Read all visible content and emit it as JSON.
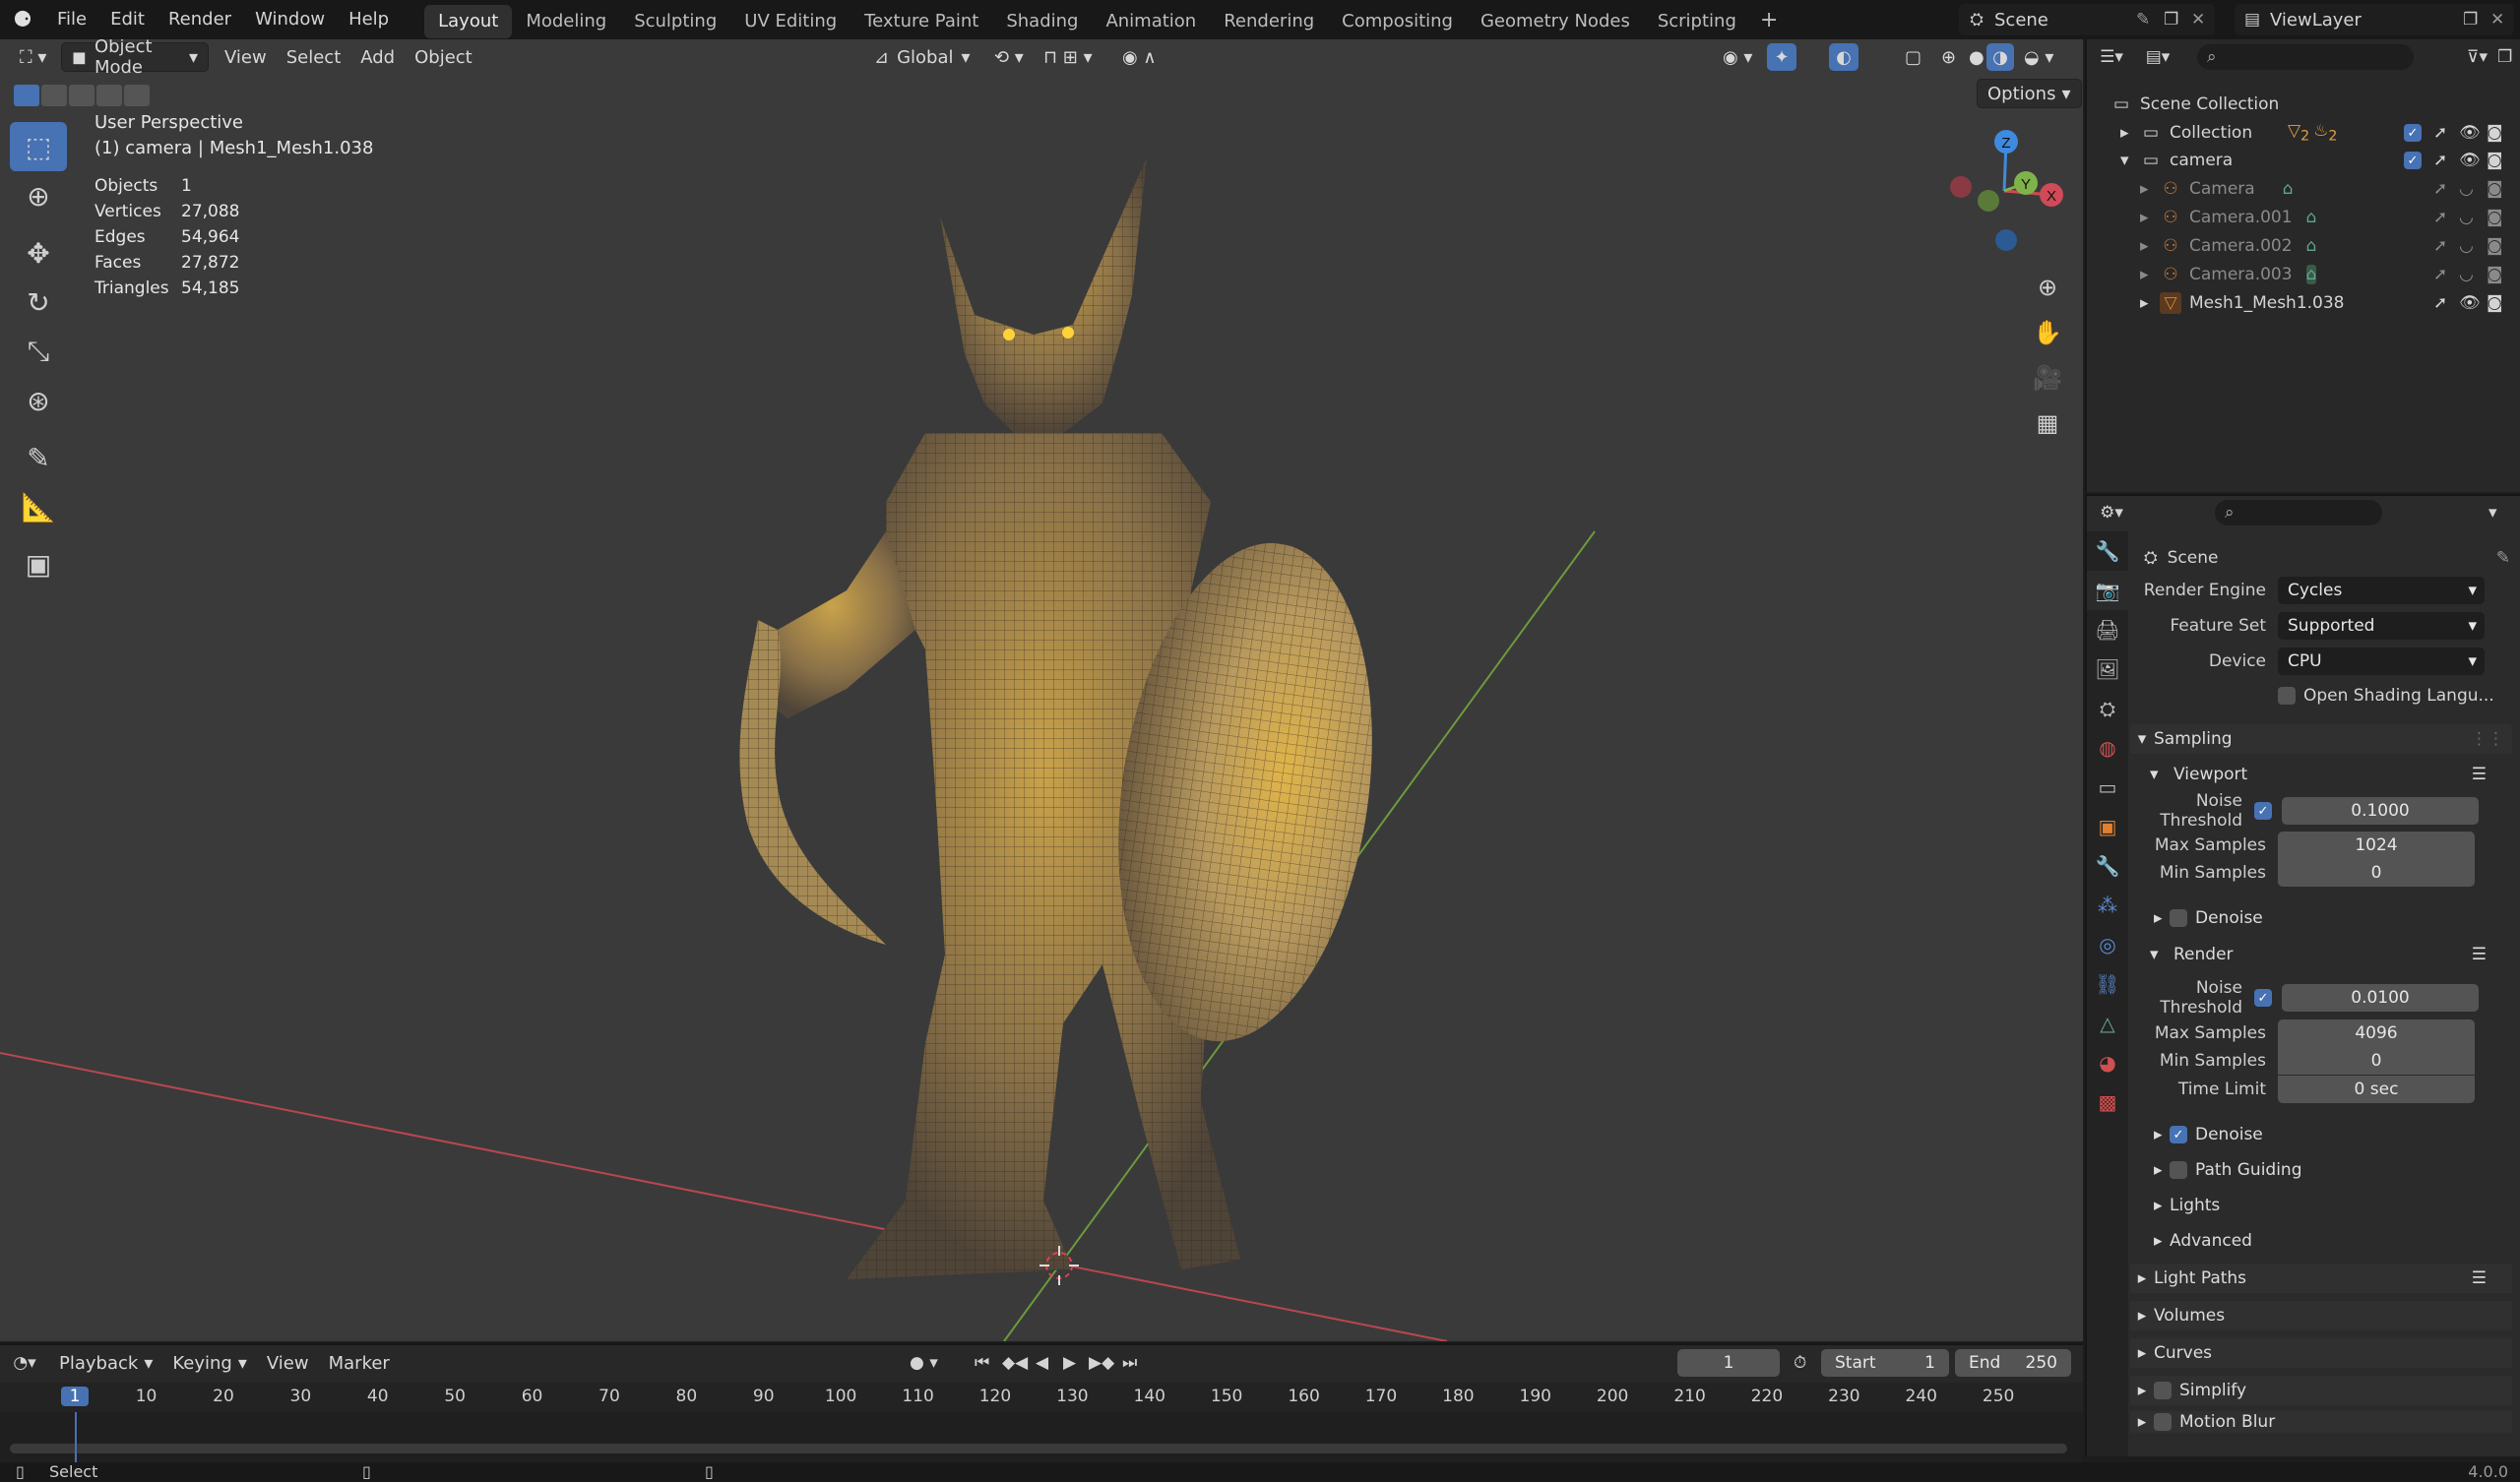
{
  "topbar": {
    "menus": [
      "File",
      "Edit",
      "Render",
      "Window",
      "Help"
    ],
    "workspaces": [
      "Layout",
      "Modeling",
      "Sculpting",
      "UV Editing",
      "Texture Paint",
      "Shading",
      "Animation",
      "Rendering",
      "Compositing",
      "Geometry Nodes",
      "Scripting"
    ],
    "active_workspace": "Layout",
    "scene_name": "Scene",
    "view_layer": "ViewLayer"
  },
  "viewport": {
    "mode": "Object Mode",
    "menus": [
      "View",
      "Select",
      "Add",
      "Object"
    ],
    "orientation": "Global",
    "options_label": "Options",
    "view_name": "User Perspective",
    "object_info": "(1) camera | Mesh1_Mesh1.038",
    "stats": [
      {
        "label": "Objects",
        "value": "1"
      },
      {
        "label": "Vertices",
        "value": "27,088"
      },
      {
        "label": "Edges",
        "value": "54,964"
      },
      {
        "label": "Faces",
        "value": "27,872"
      },
      {
        "label": "Triangles",
        "value": "54,185"
      }
    ],
    "gizmo": {
      "x": "X",
      "y": "Y",
      "z": "Z"
    }
  },
  "outliner": {
    "root": "Scene Collection",
    "items": [
      {
        "name": "Collection",
        "level": 1
      },
      {
        "name": "camera",
        "level": 1
      },
      {
        "name": "Camera",
        "level": 2
      },
      {
        "name": "Camera.001",
        "level": 2
      },
      {
        "name": "Camera.002",
        "level": 2
      },
      {
        "name": "Camera.003",
        "level": 2
      },
      {
        "name": "Mesh1_Mesh1.038",
        "level": 2
      }
    ],
    "collection_badges": [
      "2",
      "2"
    ]
  },
  "properties": {
    "context": "Scene",
    "render_engine_label": "Render Engine",
    "render_engine": "Cycles",
    "feature_set_label": "Feature Set",
    "feature_set": "Supported",
    "device_label": "Device",
    "device": "CPU",
    "osl_label": "Open Shading Langu...",
    "sampling": "Sampling",
    "viewport": "Viewport",
    "vp_noise_label": "Noise Threshold",
    "vp_noise": "0.1000",
    "vp_max_label": "Max Samples",
    "vp_max": "1024",
    "vp_min_label": "Min Samples",
    "vp_min": "0",
    "vp_denoise": "Denoise",
    "render": "Render",
    "r_noise_label": "Noise Threshold",
    "r_noise": "0.0100",
    "r_max_label": "Max Samples",
    "r_max": "4096",
    "r_min_label": "Min Samples",
    "r_min": "0",
    "r_time_label": "Time Limit",
    "r_time": "0 sec",
    "r_denoise": "Denoise",
    "path_guiding": "Path Guiding",
    "lights": "Lights",
    "advanced": "Advanced",
    "light_paths": "Light Paths",
    "volumes": "Volumes",
    "curves": "Curves",
    "simplify": "Simplify",
    "motion_blur": "Motion Blur"
  },
  "timeline": {
    "menus": [
      "Playback",
      "Keying",
      "View",
      "Marker"
    ],
    "current_frame": "1",
    "start_label": "Start",
    "start": "1",
    "end_label": "End",
    "end": "250",
    "ruler": [
      "1",
      "10",
      "20",
      "30",
      "40",
      "50",
      "60",
      "70",
      "80",
      "90",
      "100",
      "110",
      "120",
      "130",
      "140",
      "150",
      "160",
      "170",
      "180",
      "190",
      "200",
      "210",
      "220",
      "230",
      "240",
      "250"
    ]
  },
  "statusbar": {
    "select": "Select",
    "version": "4.0.0"
  },
  "colors": {
    "accent": "#4772b3",
    "x_axis": "#d04a57",
    "y_axis": "#7fb34a",
    "z_axis": "#3f8ae0",
    "gold": "#c9a24a"
  }
}
